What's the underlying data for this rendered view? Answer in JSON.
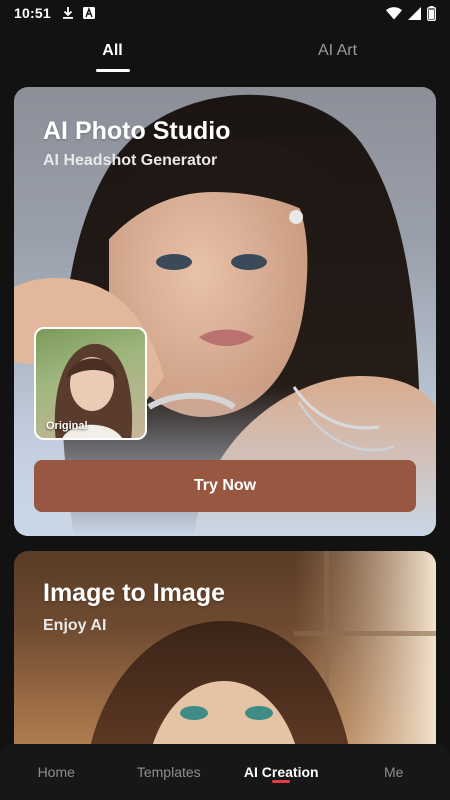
{
  "status_bar": {
    "time": "10:51",
    "left_icons": [
      "download-icon",
      "a-square-icon"
    ],
    "right_icons": [
      "wifi-icon",
      "signal-icon",
      "battery-icon"
    ]
  },
  "top_tabs": [
    {
      "label": "All",
      "active": true
    },
    {
      "label": "AI Art",
      "active": false
    }
  ],
  "cards": [
    {
      "title": "AI Photo Studio",
      "subtitle": "AI Headshot Generator",
      "thumbnail_label": "Original",
      "button_label": "Try Now"
    },
    {
      "title": "Image to Image",
      "subtitle": "Enjoy AI"
    }
  ],
  "bottom_nav": [
    {
      "label": "Home",
      "active": false
    },
    {
      "label": "Templates",
      "active": false
    },
    {
      "label": "AI Creation",
      "active": true
    },
    {
      "label": "Me",
      "active": false
    }
  ],
  "colors": {
    "background": "#121212",
    "button": "#985740",
    "nav_indicator": "#e23b4a"
  }
}
